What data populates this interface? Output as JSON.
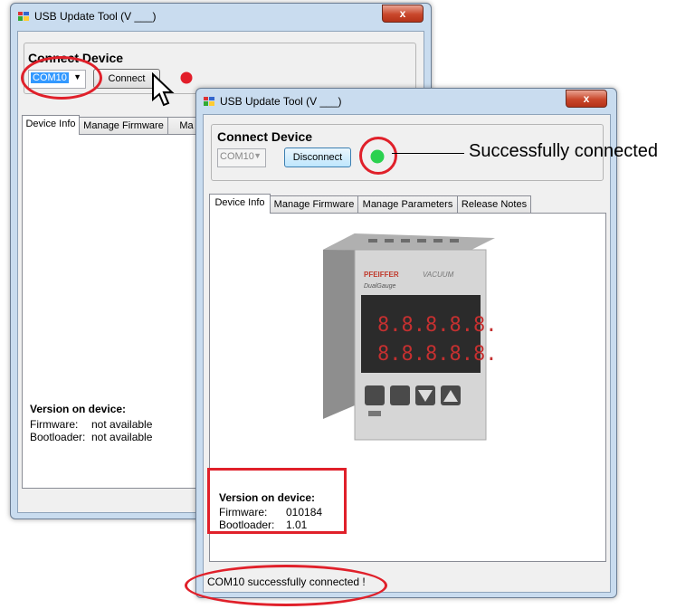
{
  "back_window": {
    "title": "USB Update Tool  (V ___)",
    "close_label": "x",
    "group_title": "Connect Device",
    "port_value": "COM10",
    "connect_label": "Connect",
    "tabs": [
      "Device Info",
      "Manage Firmware",
      "Ma"
    ],
    "version_title": "Version on device:",
    "firmware_label": "Firmware:",
    "firmware_value": "not available",
    "bootloader_label": "Bootloader:",
    "bootloader_value": "not available",
    "status_color": "#e21e2a"
  },
  "front_window": {
    "title": "USB Update Tool  (V ___)",
    "close_label": "x",
    "group_title": "Connect Device",
    "port_value": "COM10",
    "disconnect_label": "Disconnect",
    "tabs": [
      "Device Info",
      "Manage Firmware",
      "Manage Parameters",
      "Release Notes"
    ],
    "device_brand": "PFEIFFER",
    "device_brand_2": "VACUUM",
    "device_model": "DualGauge",
    "display_digits": "8.8.8.8.8.8",
    "version_title": "Version on device:",
    "firmware_label": "Firmware:",
    "firmware_value": "010184",
    "bootloader_label": "Bootloader:",
    "bootloader_value": "1.01",
    "status_text": "COM10 successfully connected !",
    "status_color": "#2bd14f"
  },
  "annotation": {
    "text": "Successfully connected",
    "highlight_color": "#e0202a"
  },
  "icons": [
    "app-icon",
    "dropdown-arrow-icon",
    "mouse-cursor-icon",
    "status-led-icon"
  ]
}
